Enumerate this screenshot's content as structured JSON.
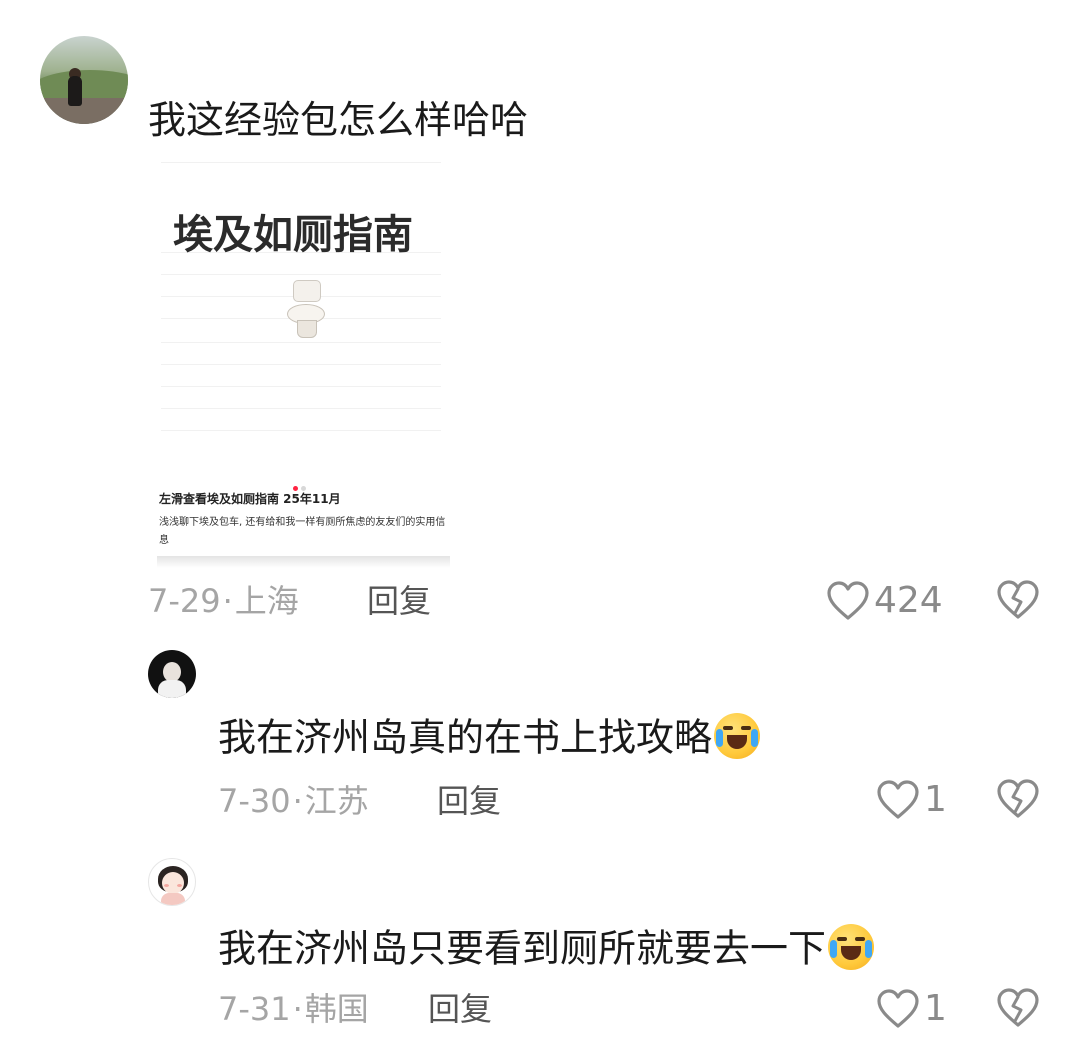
{
  "comments": [
    {
      "text": "我这经验包怎么样哈哈",
      "date": "7-29",
      "location": "上海",
      "reply_label": "回复",
      "likes": "424",
      "attachment": {
        "title": "埃及如厕指南",
        "caption": "左滑查看埃及如厕指南 25年11月",
        "description": "浅浅聊下埃及包车, 还有给和我一样有厕所焦虑的友友们的实用信息"
      }
    },
    {
      "text": "我在济州岛真的在书上找攻略",
      "date": "7-30",
      "location": "江苏",
      "reply_label": "回复",
      "likes": "1"
    },
    {
      "text": "我在济州岛只要看到厕所就要去一下",
      "date": "7-31",
      "location": "韩国",
      "reply_label": "回复",
      "likes": "1"
    }
  ],
  "meta_separator": "·",
  "colors": {
    "meta_gray": "#a5a5a5",
    "reply_gray": "#555555",
    "icon_gray": "#8a8a8a",
    "page_indicator_active": "#ff2442"
  },
  "icons": [
    "heart-icon",
    "broken-heart-icon",
    "crying-laughing-emoji",
    "toilet-emoji"
  ]
}
